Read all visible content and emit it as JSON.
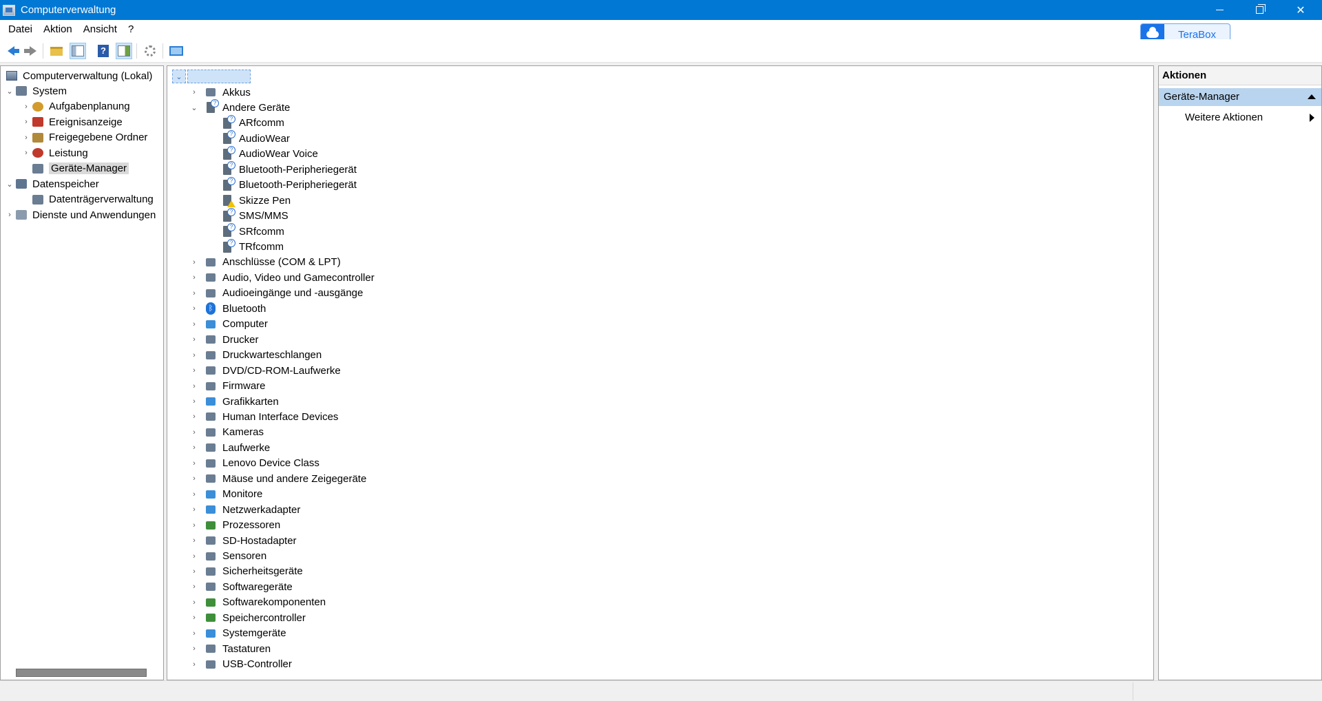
{
  "window": {
    "title": "Computerverwaltung"
  },
  "menu": [
    "Datei",
    "Aktion",
    "Ansicht",
    "?"
  ],
  "terabox": {
    "label": "TeraBox"
  },
  "toolbar_icons": [
    "back-arrow-icon",
    "forward-arrow-icon",
    "up-folder-icon",
    "show-hide-console-tree-icon",
    "help-icon",
    "show-hide-action-pane-icon",
    "properties-icon",
    "monitor-icon"
  ],
  "console_tree": {
    "root": "Computerverwaltung (Lokal)",
    "items": [
      {
        "label": "System",
        "level": 1,
        "expander": "expanded"
      },
      {
        "label": "Aufgabenplanung",
        "level": 2,
        "expander": "collapsed"
      },
      {
        "label": "Ereignisanzeige",
        "level": 2,
        "expander": "collapsed"
      },
      {
        "label": "Freigegebene Ordner",
        "level": 2,
        "expander": "collapsed"
      },
      {
        "label": "Leistung",
        "level": 2,
        "expander": "collapsed"
      },
      {
        "label": "Geräte-Manager",
        "level": 2,
        "expander": "none",
        "selected": true
      },
      {
        "label": "Datenspeicher",
        "level": 1,
        "expander": "expanded"
      },
      {
        "label": "Datenträgerverwaltung",
        "level": 2,
        "expander": "none"
      },
      {
        "label": "Dienste und Anwendungen",
        "level": 1,
        "expander": "collapsed"
      }
    ]
  },
  "device_tree": {
    "items": [
      {
        "label": "Akkus",
        "level": 1,
        "expander": "collapsed",
        "icon": "battery-icon"
      },
      {
        "label": "Andere Geräte",
        "level": 1,
        "expander": "expanded",
        "icon": "unknown-device-icon"
      },
      {
        "label": "ARfcomm",
        "level": 2,
        "expander": "none",
        "icon": "unknown-device-icon"
      },
      {
        "label": "AudioWear",
        "level": 2,
        "expander": "none",
        "icon": "unknown-device-icon"
      },
      {
        "label": "AudioWear Voice",
        "level": 2,
        "expander": "none",
        "icon": "unknown-device-icon"
      },
      {
        "label": "Bluetooth-Peripheriegerät",
        "level": 2,
        "expander": "none",
        "icon": "unknown-device-icon"
      },
      {
        "label": "Bluetooth-Peripheriegerät",
        "level": 2,
        "expander": "none",
        "icon": "unknown-device-icon"
      },
      {
        "label": "Skizze Pen",
        "level": 2,
        "expander": "none",
        "icon": "warning-device-icon"
      },
      {
        "label": "SMS/MMS",
        "level": 2,
        "expander": "none",
        "icon": "unknown-device-icon"
      },
      {
        "label": "SRfcomm",
        "level": 2,
        "expander": "none",
        "icon": "unknown-device-icon"
      },
      {
        "label": "TRfcomm",
        "level": 2,
        "expander": "none",
        "icon": "unknown-device-icon"
      },
      {
        "label": "Anschlüsse (COM & LPT)",
        "level": 1,
        "expander": "collapsed",
        "icon": "port-icon"
      },
      {
        "label": "Audio, Video und Gamecontroller",
        "level": 1,
        "expander": "collapsed",
        "icon": "speaker-icon"
      },
      {
        "label": "Audioeingänge und -ausgänge",
        "level": 1,
        "expander": "collapsed",
        "icon": "speaker-icon"
      },
      {
        "label": "Bluetooth",
        "level": 1,
        "expander": "collapsed",
        "icon": "bluetooth-icon"
      },
      {
        "label": "Computer",
        "level": 1,
        "expander": "collapsed",
        "icon": "computer-icon"
      },
      {
        "label": "Drucker",
        "level": 1,
        "expander": "collapsed",
        "icon": "printer-icon"
      },
      {
        "label": "Druckwarteschlangen",
        "level": 1,
        "expander": "collapsed",
        "icon": "printer-queue-icon"
      },
      {
        "label": "DVD/CD-ROM-Laufwerke",
        "level": 1,
        "expander": "collapsed",
        "icon": "dvd-drive-icon"
      },
      {
        "label": "Firmware",
        "level": 1,
        "expander": "collapsed",
        "icon": "firmware-icon"
      },
      {
        "label": "Grafikkarten",
        "level": 1,
        "expander": "collapsed",
        "icon": "display-adapter-icon"
      },
      {
        "label": "Human Interface Devices",
        "level": 1,
        "expander": "collapsed",
        "icon": "hid-icon"
      },
      {
        "label": "Kameras",
        "level": 1,
        "expander": "collapsed",
        "icon": "camera-icon"
      },
      {
        "label": "Laufwerke",
        "level": 1,
        "expander": "collapsed",
        "icon": "disk-drive-icon"
      },
      {
        "label": "Lenovo Device Class",
        "level": 1,
        "expander": "collapsed",
        "icon": "usb-plug-icon"
      },
      {
        "label": "Mäuse und andere Zeigegeräte",
        "level": 1,
        "expander": "collapsed",
        "icon": "mouse-icon"
      },
      {
        "label": "Monitore",
        "level": 1,
        "expander": "collapsed",
        "icon": "monitor-icon"
      },
      {
        "label": "Netzwerkadapter",
        "level": 1,
        "expander": "collapsed",
        "icon": "network-adapter-icon"
      },
      {
        "label": "Prozessoren",
        "level": 1,
        "expander": "collapsed",
        "icon": "processor-icon"
      },
      {
        "label": "SD-Hostadapter",
        "level": 1,
        "expander": "collapsed",
        "icon": "sd-host-icon"
      },
      {
        "label": "Sensoren",
        "level": 1,
        "expander": "collapsed",
        "icon": "sensor-icon"
      },
      {
        "label": "Sicherheitsgeräte",
        "level": 1,
        "expander": "collapsed",
        "icon": "security-device-icon"
      },
      {
        "label": "Softwaregeräte",
        "level": 1,
        "expander": "collapsed",
        "icon": "software-device-icon"
      },
      {
        "label": "Softwarekomponenten",
        "level": 1,
        "expander": "collapsed",
        "icon": "software-component-icon"
      },
      {
        "label": "Speichercontroller",
        "level": 1,
        "expander": "collapsed",
        "icon": "storage-controller-icon"
      },
      {
        "label": "Systemgeräte",
        "level": 1,
        "expander": "collapsed",
        "icon": "system-device-icon"
      },
      {
        "label": "Tastaturen",
        "level": 1,
        "expander": "collapsed",
        "icon": "keyboard-icon"
      },
      {
        "label": "USB-Controller",
        "level": 1,
        "expander": "collapsed",
        "icon": "usb-controller-icon"
      }
    ]
  },
  "actions": {
    "header": "Aktionen",
    "group": "Geräte-Manager",
    "item": "Weitere Aktionen"
  }
}
